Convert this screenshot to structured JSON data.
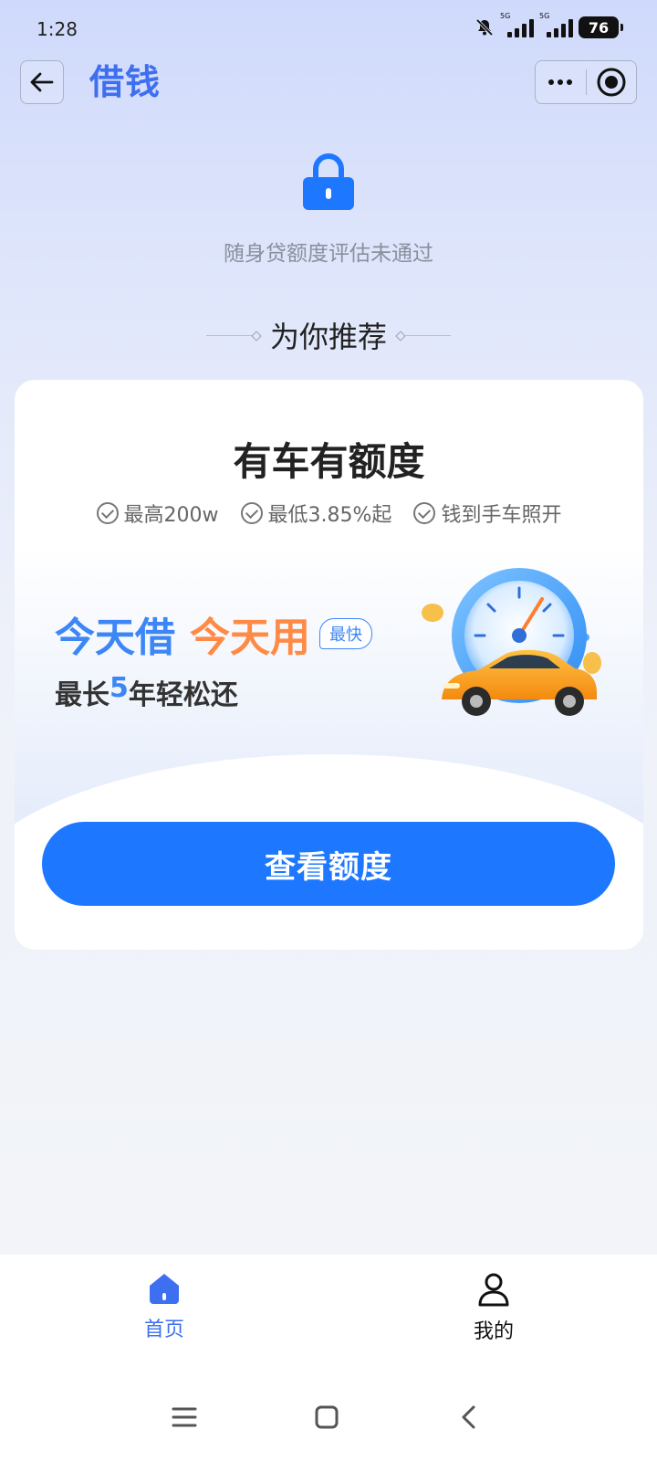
{
  "status_bar": {
    "time": "1:28",
    "network_1": "5G",
    "network_2": "5G",
    "battery": "76"
  },
  "nav": {
    "title": "借钱",
    "back_icon": "arrow-left-icon",
    "more_icon": "more-dots-icon",
    "target_icon": "record-target-icon"
  },
  "assessment": {
    "icon": "lock-icon",
    "message": "随身贷额度评估未通过"
  },
  "recommend": {
    "heading": "为你推荐"
  },
  "card": {
    "title": "有车有额度",
    "features": [
      "最高200w",
      "最低3.85%起",
      "钱到手车照开"
    ],
    "promo_borrow": "今天借",
    "promo_use": "今天用",
    "promo_badge": "最快",
    "sub_prefix": "最长",
    "sub_highlight": "5",
    "sub_suffix": "年轻松还",
    "illustration": "speedometer-car-illustration",
    "cta_label": "查看额度"
  },
  "tabbar": {
    "items": [
      {
        "label": "首页",
        "icon": "home-icon",
        "active": true
      },
      {
        "label": "我的",
        "icon": "user-icon",
        "active": false
      }
    ]
  },
  "colors": {
    "accent": "#3e6ff0",
    "cta": "#1d78ff",
    "promo_blue": "#3c86f6",
    "promo_orange": "#ff8a45",
    "car": "#f7a21b"
  }
}
